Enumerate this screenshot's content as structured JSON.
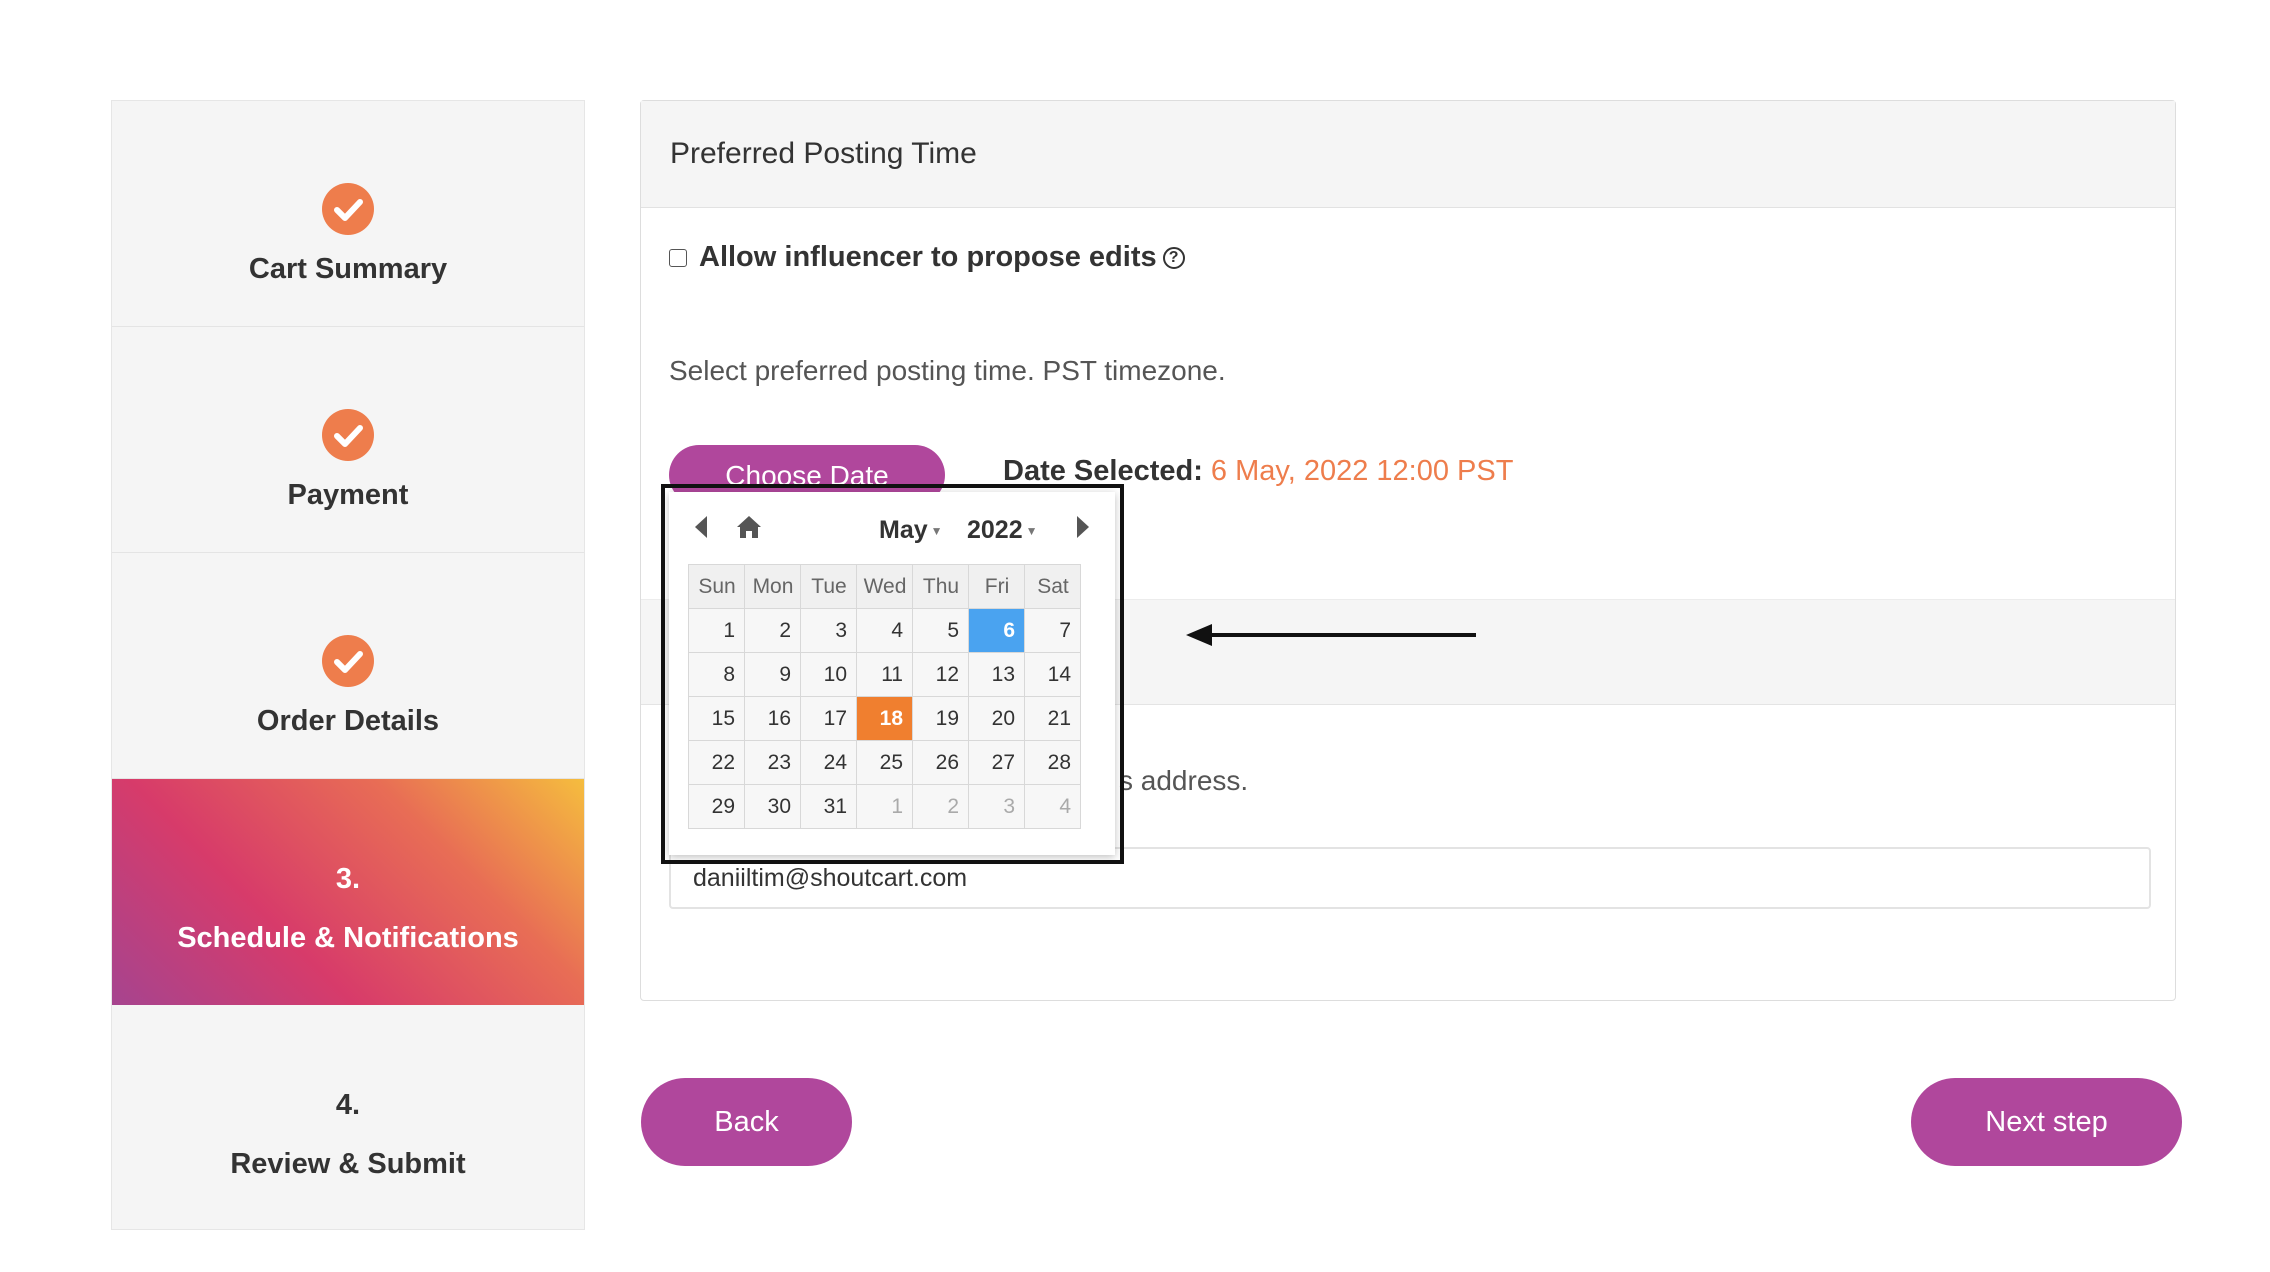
{
  "sidebar": {
    "steps": [
      {
        "label": "Cart Summary",
        "status": "done"
      },
      {
        "label": "Payment",
        "status": "done"
      },
      {
        "label": "Order Details",
        "status": "done"
      },
      {
        "number": "3.",
        "label": "Schedule & Notifications",
        "status": "active"
      },
      {
        "number": "4.",
        "label": "Review & Submit",
        "status": "pending"
      }
    ]
  },
  "panel": {
    "title": "Preferred Posting Time",
    "allow_edits_label": "Allow influencer to propose edits",
    "help_symbol": "?",
    "posting_hint": "Select preferred posting time. PST timezone.",
    "choose_date_label": "Choose Date",
    "date_selected_label": "Date Selected:",
    "date_selected_value": "6 May, 2022 12:00 PST",
    "email_hint_partial": "s address.",
    "email_value": "daniiltim@shoutcart.com"
  },
  "buttons": {
    "back": "Back",
    "next": "Next step"
  },
  "datepicker": {
    "month": "May",
    "year": "2022",
    "weekdays": [
      "Sun",
      "Mon",
      "Tue",
      "Wed",
      "Thu",
      "Fri",
      "Sat"
    ],
    "weeks": [
      [
        "1",
        "2",
        "3",
        "4",
        "5",
        "6",
        "7"
      ],
      [
        "8",
        "9",
        "10",
        "11",
        "12",
        "13",
        "14"
      ],
      [
        "15",
        "16",
        "17",
        "18",
        "19",
        "20",
        "21"
      ],
      [
        "22",
        "23",
        "24",
        "25",
        "26",
        "27",
        "28"
      ],
      [
        "29",
        "30",
        "31",
        "1",
        "2",
        "3",
        "4"
      ]
    ],
    "selected_day": "6",
    "today": "18"
  },
  "colors": {
    "accent_purple": "#b0479c",
    "accent_orange": "#ee7d4c",
    "selected_blue": "#4aa3f0",
    "today_orange": "#f07f2f"
  }
}
